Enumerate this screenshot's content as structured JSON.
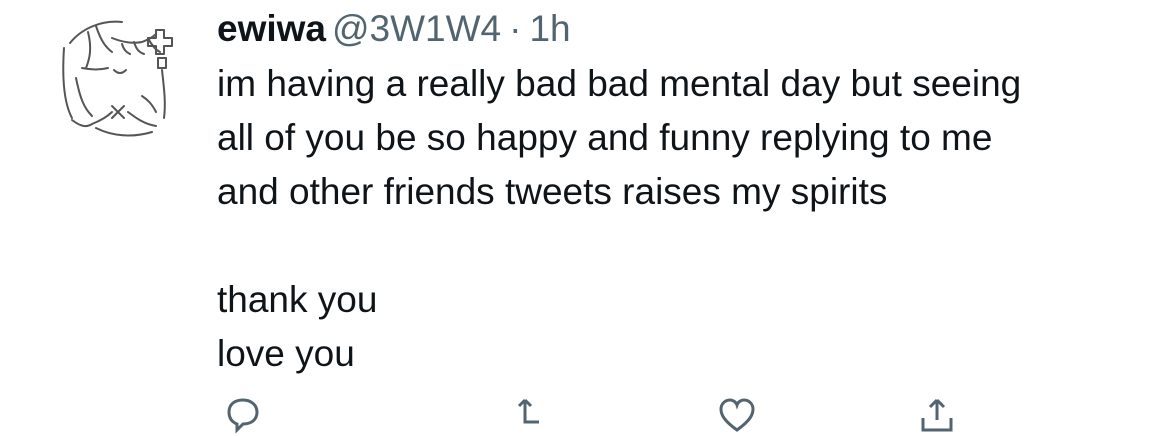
{
  "tweet": {
    "display_name": "ewiwa",
    "handle": "@3W1W4",
    "separator": "·",
    "time": "1h",
    "lines": [
      "im having a really bad bad mental day but seeing",
      "all of you be so happy and funny replying to me",
      "and other friends tweets raises my spirits",
      "",
      "thank you",
      "love you"
    ]
  },
  "avatar": {
    "icon": "sketch-avatar-icon"
  },
  "actions": {
    "icons": [
      "reply-icon",
      "retweet-icon",
      "like-icon",
      "share-icon"
    ]
  },
  "colors": {
    "text": "#0f1419",
    "secondary": "#536471",
    "background": "#ffffff"
  }
}
